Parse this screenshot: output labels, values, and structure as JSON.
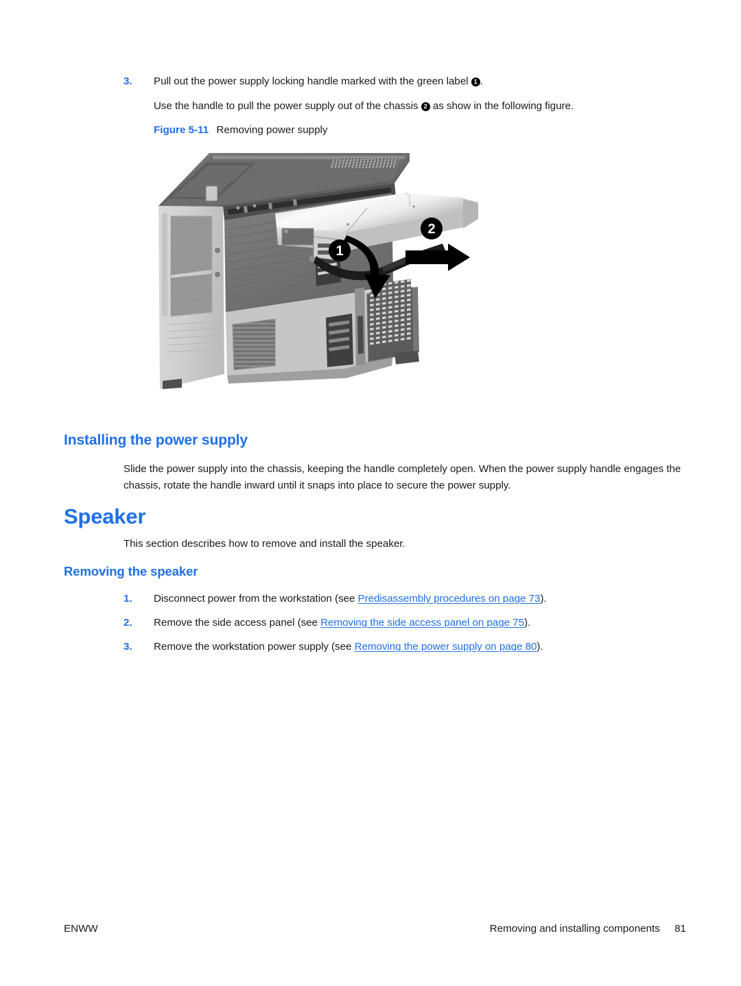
{
  "step_3_top": {
    "number": "3.",
    "text_before": "Pull out the power supply locking handle marked with the green label",
    "callout": "1",
    "text_after": "."
  },
  "step_3_continued": {
    "text_before": "Use the handle to pull the power supply out of the chassis",
    "callout": "2",
    "text_after": "as show in the following figure."
  },
  "figure_caption": {
    "label": "Figure 5-11",
    "title": "Removing power supply"
  },
  "figure": {
    "alt": "Workstation tower chassis with power supply handle rotated down and power supply sliding out",
    "callouts": [
      {
        "id": "1",
        "meaning": "rotate locking handle outward and down"
      },
      {
        "id": "2",
        "meaning": "pull power supply out of chassis"
      }
    ]
  },
  "installing_heading": "Installing the power supply",
  "installing_paragraph": "Slide the power supply into the chassis, keeping the handle completely open. When the power supply handle engages the chassis, rotate the handle inward until it snaps into place to secure the power supply.",
  "speaker_heading": "Speaker",
  "speaker_paragraph": "This section describes how to remove and install the speaker.",
  "removing_speaker_heading": "Removing the speaker",
  "removing_speaker_steps": [
    {
      "number": "1.",
      "text_before": "Disconnect power from the workstation (see",
      "link": "Predisassembly procedures on page 73",
      "text_after": ")."
    },
    {
      "number": "2.",
      "text_before": "Remove the side access panel (see",
      "link": "Removing the side access panel on page 75",
      "text_after": ")."
    },
    {
      "number": "3.",
      "text_before": "Remove the workstation power supply (see",
      "link": "Removing the power supply on page 80",
      "text_after": ")."
    }
  ],
  "footer": {
    "left": "ENWW",
    "right": "Removing and installing components",
    "page_number": "81"
  },
  "colors": {
    "heading_blue": "#1f6fe8",
    "link_blue": "#1f6fe8",
    "body_black": "#1a1a1a",
    "page_background": "#ffffff"
  }
}
